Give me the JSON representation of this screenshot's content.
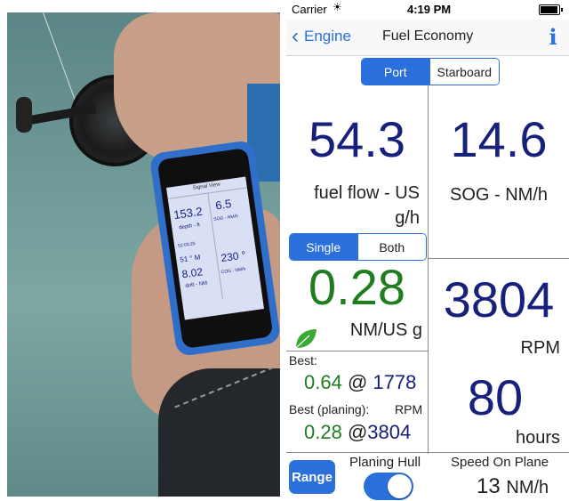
{
  "status": {
    "carrier": "Carrier",
    "time": "4:19 PM"
  },
  "nav": {
    "back_label": "Engine",
    "title": "Fuel Economy",
    "info_label": "i"
  },
  "engine_segment": {
    "port": "Port",
    "starboard": "Starboard",
    "selected": "Port"
  },
  "fuel_flow": {
    "value": "54.3",
    "label_line1": "fuel flow - US",
    "label_line2": "g/h"
  },
  "sog": {
    "value": "14.6",
    "label": "SOG - NM/h"
  },
  "mode_segment": {
    "single": "Single",
    "both": "Both",
    "selected": "Single"
  },
  "economy": {
    "value": "0.28",
    "unit": "NM/US g"
  },
  "best": {
    "label": "Best:",
    "value": "0.64",
    "at": "@",
    "rpm": "1778"
  },
  "best_planing": {
    "label": "Best (planing):",
    "rpm_header": "RPM",
    "value": "0.28",
    "at": "@",
    "rpm": "3804"
  },
  "rpm": {
    "value": "3804",
    "label": "RPM"
  },
  "hours": {
    "value": "80",
    "label": "hours"
  },
  "range_button": "Range",
  "planing_hull": {
    "label": "Planing Hull",
    "on": true
  },
  "speed_on_plane": {
    "label": "Speed On Plane",
    "value": "13",
    "unit": "NM/h"
  },
  "phone_screen": {
    "header": "Signal View",
    "depth_value": "153.2",
    "depth_label": "depth - ft",
    "sog_value": "6.5",
    "sog_label": "SOG - NM/h",
    "time_value": "52:03:25",
    "heading_value": "51 ° M",
    "drift_value": "8.02",
    "drift_label": "drift - NM",
    "cog_value": "230 °",
    "cog_label": "COG - NM/h"
  },
  "colors": {
    "accent": "#2a6fdb",
    "value_navy": "#17207a",
    "value_green": "#1f7d1f",
    "leaf": "#3aa935"
  }
}
